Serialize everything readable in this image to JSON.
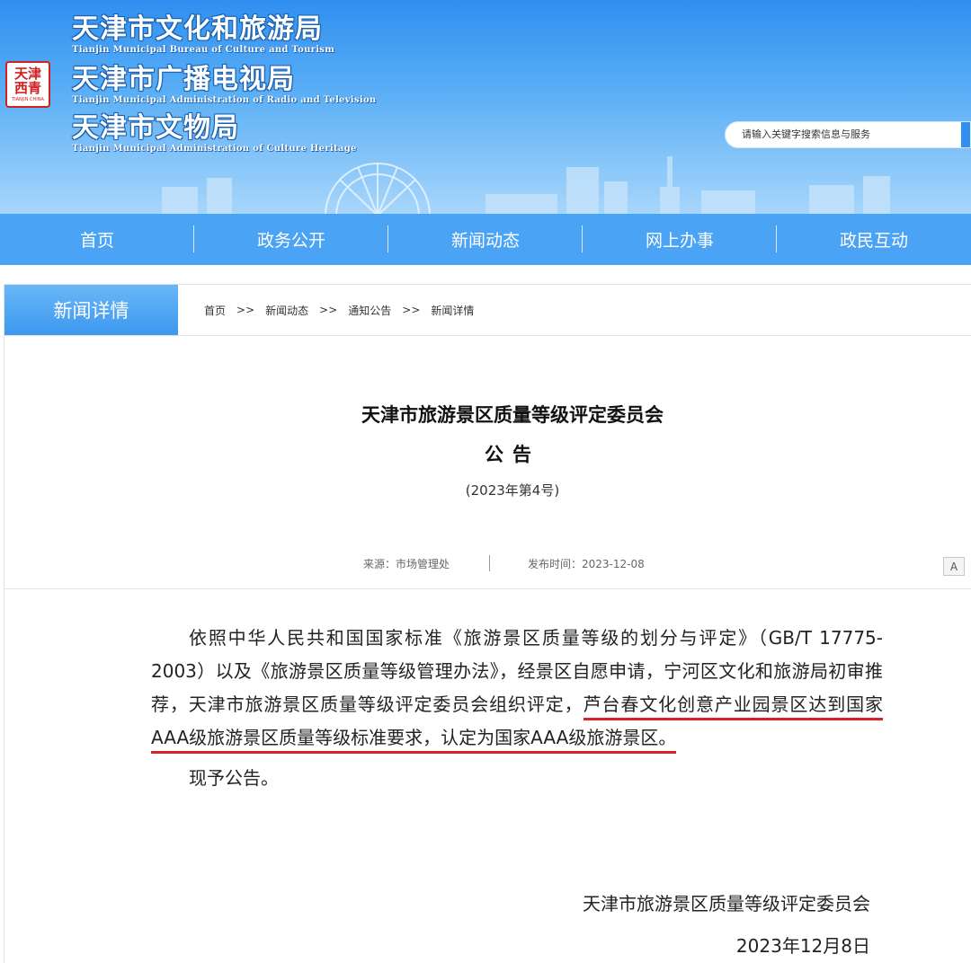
{
  "header": {
    "seal": {
      "chars": "天津\n西青",
      "sub": "TIANJIN CHINA"
    },
    "orgs": [
      {
        "cn": "天津市文化和旅游局",
        "en": "Tianjin Municipal Bureau of Culture and Tourism"
      },
      {
        "cn": "天津市广播电视局",
        "en": "Tianjin Municipal Administration of Radio and Television"
      },
      {
        "cn": "天津市文物局",
        "en": "Tianjin Municipal Administration of Culture Heritage"
      }
    ],
    "search": {
      "placeholder": "请输入关键字搜索信息与服务"
    }
  },
  "nav": {
    "items": [
      "首页",
      "政务公开",
      "新闻动态",
      "网上办事",
      "政民互动"
    ]
  },
  "breadcrumb": {
    "section_title": "新闻详情",
    "items": [
      "首页",
      "新闻动态",
      "通知公告",
      "新闻详情"
    ],
    "separator": ">>"
  },
  "article": {
    "title_line1": "天津市旅游景区质量等级评定委员会",
    "title_line2": "公告",
    "title_line3": "(2023年第4号)",
    "source": "来源：市场管理处",
    "publish_time": "发布时间：2023-12-08",
    "font_size_button": "A",
    "paragraph1_plain": "依照中华人民共和国国家标准《旅游景区质量等级的划分与评定》（GB/T 17775-2003）以及《旅游景区质量等级管理办法》，经景区自愿申请，宁河区文化和旅游局初审推荐，天津市旅游景区质量等级评定委员会组织评定，",
    "paragraph1_highlight": "芦台春文化创意产业园景区达到国家AAA级旅游景区质量等级标准要求，认定为国家AAA级旅游景区。",
    "paragraph2": "现予公告。",
    "signature": "天津市旅游景区质量等级评定委员会",
    "date": "2023年12月8日"
  },
  "colors": {
    "header_top": "#2f8ff0",
    "nav_bg": "#4aa3f4",
    "highlight_underline": "#d8202d"
  }
}
